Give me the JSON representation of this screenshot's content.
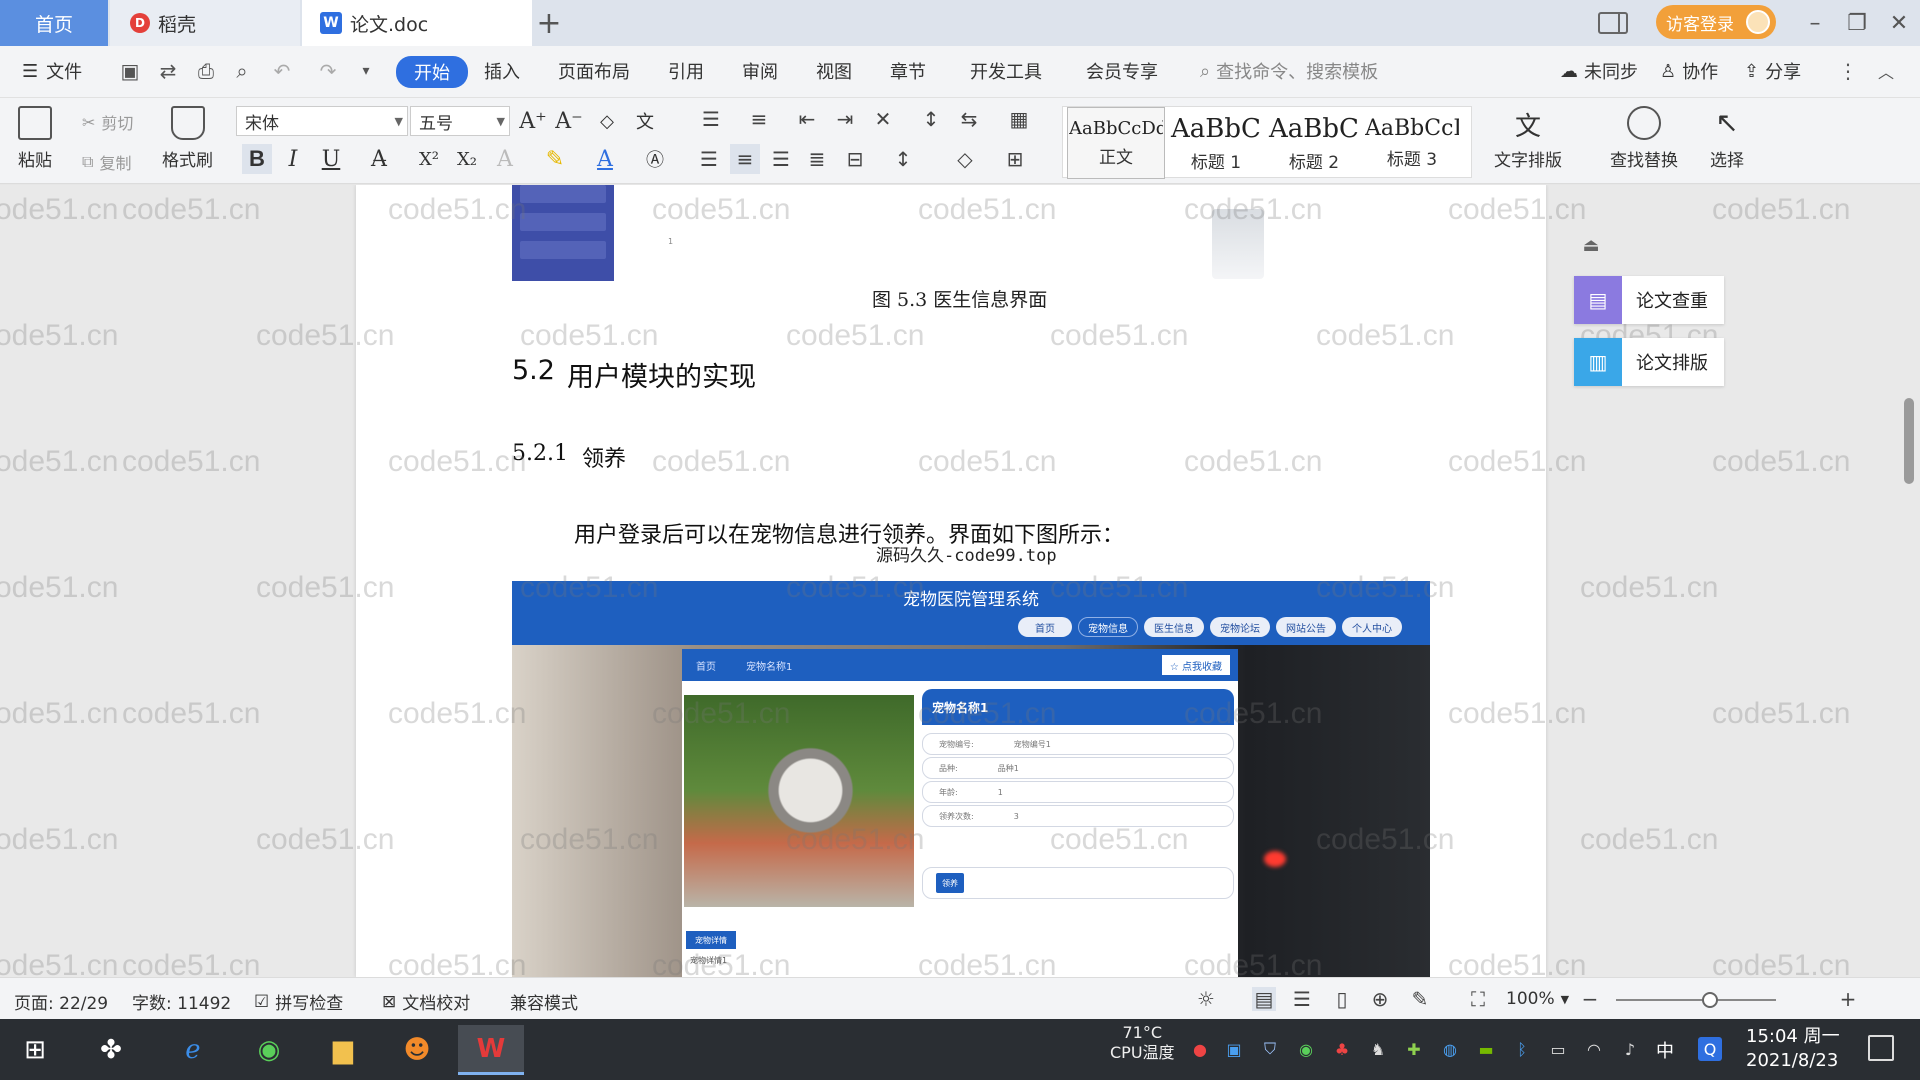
{
  "tabs": {
    "home": "首页",
    "docer": "稻壳",
    "doc": "论文.doc",
    "new_tab": "+"
  },
  "titlebar": {
    "guest_login": "访客登录"
  },
  "menu": {
    "file": "文件",
    "items": [
      "开始",
      "插入",
      "页面布局",
      "引用",
      "审阅",
      "视图",
      "章节",
      "开发工具",
      "会员专享"
    ],
    "search_placeholder": "查找命令、搜索模板",
    "not_synced": "未同步",
    "collaborate": "协作",
    "share": "分享"
  },
  "ribbon": {
    "paste": "粘贴",
    "cut": "剪切",
    "copy": "复制",
    "format_painter": "格式刷",
    "font_name": "宋体",
    "font_size": "五号",
    "styles": [
      {
        "sample": "AaBbCcDd",
        "name": "正文"
      },
      {
        "sample": "AaBbC",
        "name": "标题 1"
      },
      {
        "sample": "AaBbC",
        "name": "标题 2"
      },
      {
        "sample": "AaBbCcI",
        "name": "标题 3"
      }
    ],
    "text_layout": "文字排版",
    "find_replace": "查找替换",
    "select": "选择"
  },
  "document": {
    "figure_caption": "图 5.3  医生信息界面",
    "heading2_num": "5.2",
    "heading2_text": "用户模块的实现",
    "heading3_num": "5.2.1",
    "heading3_text": "领养",
    "body_text": "用户登录后可以在宠物信息进行领养。界面如下图所示：",
    "source_watermark": "源码久久-code99.top",
    "watermark_text": "code51.cn"
  },
  "embedded_screenshot": {
    "title": "宠物医院管理系统",
    "nav": [
      "首页",
      "宠物信息",
      "医生信息",
      "宠物论坛",
      "网站公告",
      "个人中心"
    ],
    "breadcrumb_home": "首页",
    "breadcrumb_current": "宠物名称1",
    "favorite_button": "☆ 点我收藏",
    "info_title": "宠物名称1",
    "fields": [
      {
        "label": "宠物编号:",
        "value": "宠物编号1"
      },
      {
        "label": "品种:",
        "value": "品种1"
      },
      {
        "label": "年龄:",
        "value": "1"
      },
      {
        "label": "领养次数:",
        "value": "3"
      }
    ],
    "adopt_button": "领养",
    "detail_tab": "宠物详情",
    "detail_text": "宠物详情1"
  },
  "sidebar": {
    "plagiarism_check": "论文查重",
    "paper_layout": "论文排版"
  },
  "statusbar": {
    "page": "页面: 22/29",
    "word_count": "字数: 11492",
    "spell_check": "拼写检查",
    "doc_proof": "文档校对",
    "compat_mode": "兼容模式",
    "zoom": "100%",
    "zoom_level": 1.0
  },
  "taskbar": {
    "cpu_temp": "71°C",
    "cpu_label": "CPU温度",
    "ime": "中",
    "time": "15:04 周一",
    "date": "2021/8/23"
  },
  "colors": {
    "accent": "#2f6fe0",
    "home_tab": "#5b8fe0",
    "guest_login": "#f2a03a",
    "site_blue": "#1e5fbf"
  }
}
